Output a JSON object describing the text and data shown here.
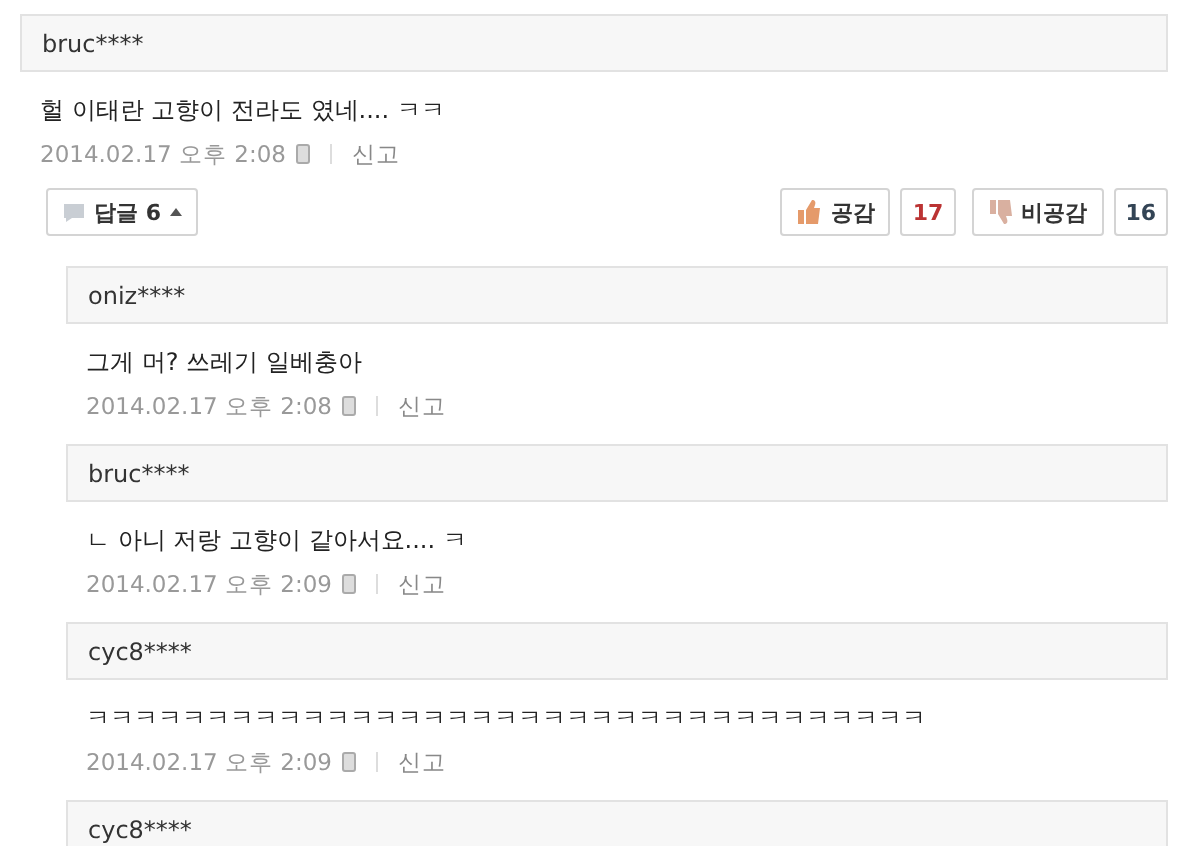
{
  "comment": {
    "author": "bruc****",
    "text": "헐 이태란 고향이 전라도 였네.... ㅋㅋ",
    "date": "2014.02.17 오후 2:08",
    "report": "신고",
    "reply_button": {
      "label": "답글",
      "count": "6",
      "expanded": true
    },
    "like": {
      "label": "공감",
      "count": "17"
    },
    "dislike": {
      "label": "비공감",
      "count": "16"
    }
  },
  "replies": [
    {
      "author": "oniz****",
      "text": "그게 머? 쓰레기 일베충아",
      "date": "2014.02.17 오후 2:08",
      "report": "신고"
    },
    {
      "author": "bruc****",
      "text": "ㄴ 아니 저랑 고향이 같아서요.... ㅋ",
      "date": "2014.02.17 오후 2:09",
      "report": "신고"
    },
    {
      "author": "cyc8****",
      "text": "ㅋㅋㅋㅋㅋㅋㅋㅋㅋㅋㅋㅋㅋㅋㅋㅋㅋㅋㅋㅋㅋㅋㅋㅋㅋㅋㅋㅋㅋㅋㅋㅋㅋㅋㅋ",
      "date": "2014.02.17 오후 2:09",
      "report": "신고"
    },
    {
      "author": "cyc8****"
    }
  ]
}
